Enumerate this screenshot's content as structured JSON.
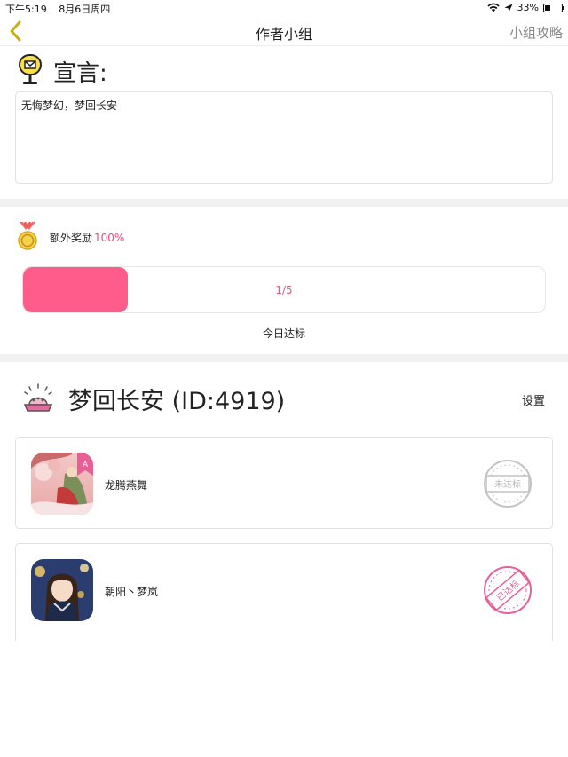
{
  "status_bar": {
    "time": "下午5:19",
    "date": "8月6日周四",
    "battery_text": "33%",
    "battery_level": 0.33
  },
  "nav": {
    "title": "作者小组",
    "right_link": "小组攻略"
  },
  "declaration": {
    "title": "宣言:",
    "text": "无悔梦幻，梦回长安"
  },
  "reward": {
    "label": "额外奖励",
    "percent": "100%",
    "progress_text": "1/5",
    "progress_fraction": 0.2,
    "today_label": "今日达标"
  },
  "group": {
    "title": "梦回长安 (ID:4919)",
    "settings_label": "设置",
    "members": [
      {
        "name": "龙腾燕舞",
        "status": "未达标",
        "achieved": false
      },
      {
        "name": "朝阳丶梦岚",
        "status": "已达标",
        "achieved": true
      }
    ]
  },
  "colors": {
    "accent_pink": "#ff5b8b",
    "back_arrow": "#c8b014",
    "stamp_grey": "#c4c4c4",
    "stamp_pink": "#e8609a"
  },
  "icons": {
    "back": "chevron-left-icon",
    "wifi": "wifi-icon",
    "location": "location-arrow-icon",
    "mailbox": "mailbox-icon",
    "medal": "medal-icon",
    "group": "crown-badge-icon"
  }
}
